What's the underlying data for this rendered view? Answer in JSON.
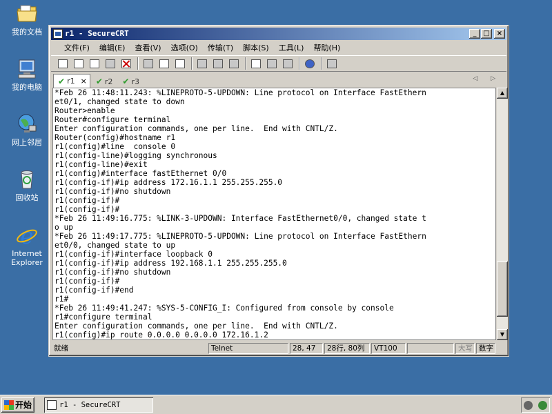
{
  "desktop": {
    "icons": [
      {
        "label": "我的文档"
      },
      {
        "label": "我的电脑"
      },
      {
        "label": "网上邻居"
      },
      {
        "label": "回收站"
      },
      {
        "label_line1": "Internet",
        "label_line2": "Explorer"
      }
    ]
  },
  "window": {
    "title": "r1 - SecureCRT",
    "buttons": {
      "minimize": "_",
      "maximize": "□",
      "close": "×"
    }
  },
  "menu": [
    "文件(F)",
    "编辑(E)",
    "查看(V)",
    "选项(O)",
    "传输(T)",
    "脚本(S)",
    "工具(L)",
    "帮助(H)"
  ],
  "tabs": [
    {
      "label": "r1",
      "active": true,
      "close": "×"
    },
    {
      "label": "r2",
      "active": false
    },
    {
      "label": "r3",
      "active": false
    }
  ],
  "tab_nav": "◁ ▷",
  "terminal": {
    "lines": [
      "*Feb 26 11:48:11.243: %LINEPROTO-5-UPDOWN: Line protocol on Interface FastEthern",
      "et0/1, changed state to down",
      "Router>enable",
      "Router#configure terminal",
      "Enter configuration commands, one per line.  End with CNTL/Z.",
      "Router(config)#hostname r1",
      "r1(config)#line  console 0",
      "r1(config-line)#logging synchronous",
      "r1(config-line)#exit",
      "r1(config)#interface fastEthernet 0/0",
      "r1(config-if)#ip address 172.16.1.1 255.255.255.0",
      "r1(config-if)#no shutdown",
      "r1(config-if)#",
      "r1(config-if)#",
      "*Feb 26 11:49:16.775: %LINK-3-UPDOWN: Interface FastEthernet0/0, changed state t",
      "o up",
      "*Feb 26 11:49:17.775: %LINEPROTO-5-UPDOWN: Line protocol on Interface FastEthern",
      "et0/0, changed state to up",
      "r1(config-if)#interface loopback 0",
      "r1(config-if)#ip address 192.168.1.1 255.255.255.0",
      "r1(config-if)#no shutdown",
      "r1(config-if)#",
      "r1(config-if)#end",
      "r1#",
      "*Feb 26 11:49:41.247: %SYS-5-CONFIG_I: Configured from console by console",
      "r1#configure terminal",
      "Enter configuration commands, one per line.  End with CNTL/Z.",
      "r1(config)#ip route 0.0.0.0 0.0.0.0 172.16.1.2"
    ],
    "scroll_position": 0.93
  },
  "statusbar": {
    "status": "就绪",
    "protocol": "Telnet",
    "cursor": "28, 47",
    "size": "28行, 80列",
    "emulation": "VT100",
    "blank": "",
    "caps": "大写",
    "num": "数字"
  },
  "taskbar": {
    "start_label": "开始",
    "task_label": "r1 - SecureCRT"
  },
  "colors": {
    "desktop": "#3a6ea5",
    "titlebar_start": "#0a246a",
    "titlebar_end": "#a6caf0"
  }
}
